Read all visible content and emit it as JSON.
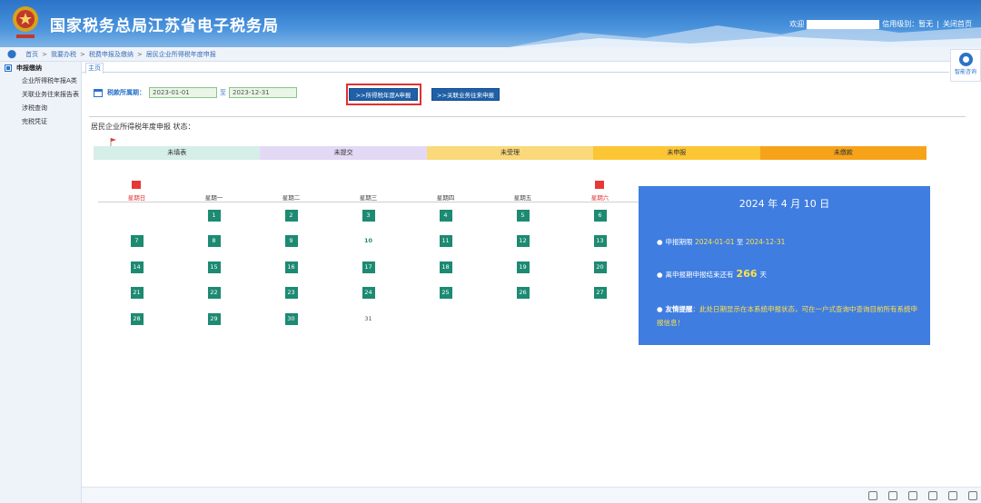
{
  "header": {
    "title": "国家税务总局江苏省电子税务局",
    "welcome": "欢迎",
    "credit_label": "信用级别：暂无",
    "close_label": "关闭首页"
  },
  "breadcrumb": [
    "首页",
    "我要办税",
    "税费申报及缴纳",
    "居民企业所得税年度申报"
  ],
  "sidebar": {
    "heading": "申报缴纳",
    "items": [
      "企业所得税年报A类",
      "关联业务往来报告表",
      "涉税查询",
      "完税凭证"
    ]
  },
  "tab": {
    "home": "主页"
  },
  "help": {
    "label": "智能咨询"
  },
  "period": {
    "label": "税款所属期：",
    "start": "2023-01-01",
    "to": "至",
    "end": "2023-12-31"
  },
  "buttons": {
    "annual": ">>所得税年度A申报",
    "related": ">>关联业务往来申报"
  },
  "status": {
    "title": "居民企业所得税年度申报 状态：",
    "stages": [
      {
        "label": "未填表",
        "color": "#d6eee8"
      },
      {
        "label": "未提交",
        "color": "#e3d9f5"
      },
      {
        "label": "未受理",
        "color": "#fad97a"
      },
      {
        "label": "未申报",
        "color": "#fbc534"
      },
      {
        "label": "未缴款",
        "color": "#f6a31a"
      }
    ]
  },
  "calendar": {
    "weekdays": [
      "星期日",
      "星期一",
      "星期二",
      "星期三",
      "星期四",
      "星期五",
      "星期六"
    ],
    "rows": [
      [
        "",
        "1",
        "2",
        "3",
        "4",
        "5",
        "6"
      ],
      [
        "7",
        "8",
        "9",
        "10",
        "11",
        "12",
        "13"
      ],
      [
        "14",
        "15",
        "16",
        "17",
        "18",
        "19",
        "20"
      ],
      [
        "21",
        "22",
        "23",
        "24",
        "25",
        "26",
        "27"
      ],
      [
        "28",
        "29",
        "30",
        "31",
        "",
        "",
        ""
      ]
    ],
    "today": "10",
    "plain_days": [
      "31"
    ]
  },
  "info": {
    "date": "2024 年 4 月 10 日",
    "period_label": "申报期限",
    "period_start": "2024-01-01",
    "period_to": "至",
    "period_end": "2024-12-31",
    "remain_prefix": "离申报期申报结束还有",
    "remain_days": "266",
    "remain_suffix": "天",
    "tip_label": "友情提醒",
    "tip_text": "：此处日期显示在本系统申报状态，可在一户式查询中查询目前所有系统申报信息！"
  }
}
